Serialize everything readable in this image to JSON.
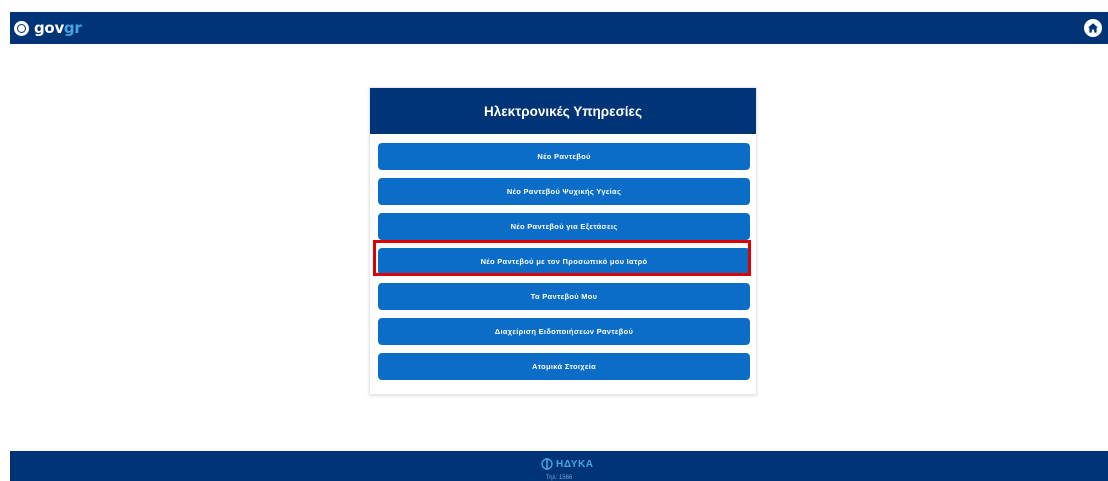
{
  "header": {
    "logo_gov": "gov",
    "logo_gr": "gr",
    "home_icon": "home-icon"
  },
  "card": {
    "title": "Ηλεκτρονικές Υπηρεσίες",
    "items": [
      {
        "label": "Νέο Ραντεβού"
      },
      {
        "label": "Νέο Ραντεβού Ψυχικής Υγείας"
      },
      {
        "label": "Νέο Ραντεβού για Εξετάσεις"
      },
      {
        "label": "Νέο Ραντεβού με τον Προσωπικό μου Ιατρό",
        "highlighted": true
      },
      {
        "label": "Τα Ραντεβού Μου"
      },
      {
        "label": "Διαχείριση Ειδοποιήσεων Ραντεβού"
      },
      {
        "label": "Ατομικά Στοιχεία"
      }
    ]
  },
  "footer": {
    "logo_text": "ΗΔΥΚΑ",
    "sub_text": "Τηλ: 1566"
  },
  "colors": {
    "navy": "#003476",
    "button_blue": "#0b6dc7",
    "accent_light_blue": "#4aa3df",
    "highlight_red": "#e00000"
  }
}
